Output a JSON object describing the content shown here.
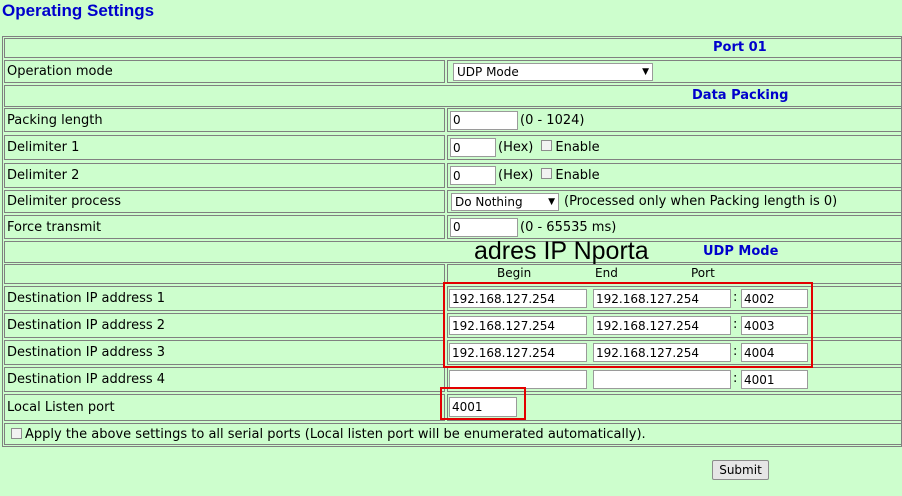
{
  "page_title": "Operating Settings",
  "port_header": "Port 01",
  "operation_mode": {
    "label": "Operation mode",
    "value": "UDP Mode"
  },
  "data_packing": {
    "header": "Data Packing",
    "packing_length": {
      "label": "Packing length",
      "value": "0",
      "hint": "(0 - 1024)"
    },
    "delimiter1": {
      "label": "Delimiter 1",
      "value": "0",
      "hex": "(Hex)",
      "enable": "Enable"
    },
    "delimiter2": {
      "label": "Delimiter 2",
      "value": "0",
      "hex": "(Hex)",
      "enable": "Enable"
    },
    "delimiter_process": {
      "label": "Delimiter process",
      "value": "Do Nothing",
      "hint": "(Processed only when Packing length is 0)"
    },
    "force_transmit": {
      "label": "Force transmit",
      "value": "0",
      "hint": "(0 - 65535 ms)"
    }
  },
  "udp_mode": {
    "header": "UDP Mode",
    "overlay_note": "adres IP Nporta",
    "columns": {
      "begin": "Begin",
      "end": "End",
      "port": "Port"
    },
    "destinations": [
      {
        "label": "Destination IP address 1",
        "begin": "192.168.127.254",
        "end": "192.168.127.254",
        "port": "4002"
      },
      {
        "label": "Destination IP address 2",
        "begin": "192.168.127.254",
        "end": "192.168.127.254",
        "port": "4003"
      },
      {
        "label": "Destination IP address 3",
        "begin": "192.168.127.254",
        "end": "192.168.127.254",
        "port": "4004"
      },
      {
        "label": "Destination IP address 4",
        "begin": "",
        "end": "",
        "port": "4001"
      }
    ],
    "local_listen": {
      "label": "Local Listen port",
      "value": "4001"
    }
  },
  "apply_all": "Apply the above settings to all serial ports (Local listen port will be enumerated automatically).",
  "submit_label": "Submit",
  "colors": {
    "background": "#cdfecd",
    "heading": "#0000cc",
    "highlight": "#e30000"
  }
}
